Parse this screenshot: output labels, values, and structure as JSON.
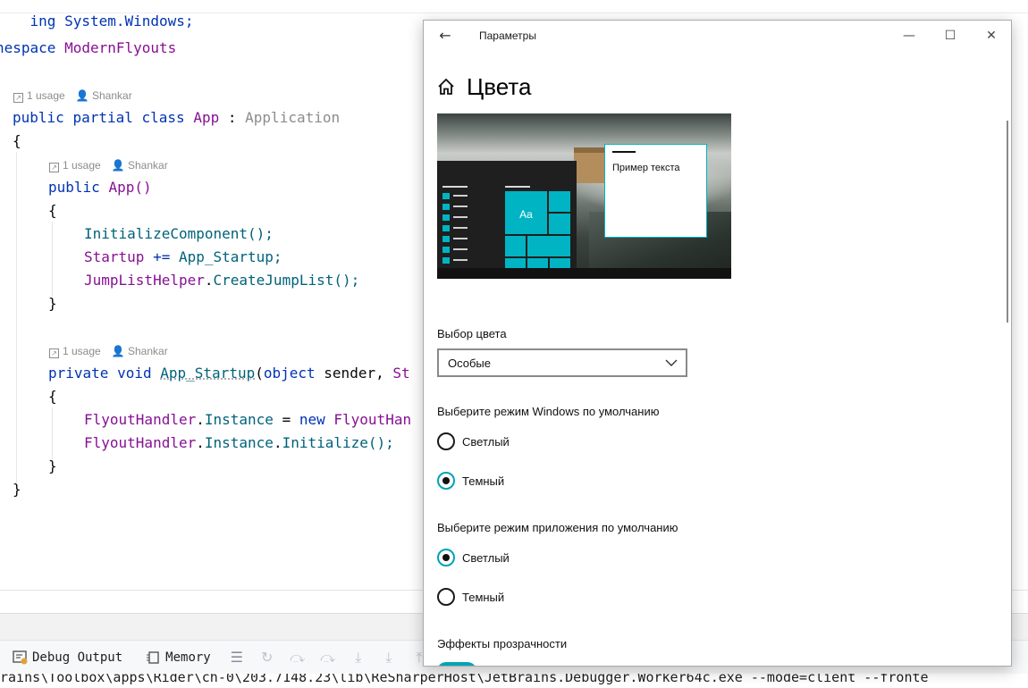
{
  "editor": {
    "line_using": "ing System.Windows;",
    "ns_keyword": "nespace",
    "ns_name": "ModernFlyouts",
    "hint_usage": "1 usage",
    "hint_author": "Shankar",
    "class_public": "public",
    "class_partial": "partial",
    "class_class": "class",
    "class_name": "App",
    "class_colon": ":",
    "class_base": "Application",
    "brace_open": "{",
    "brace_close": "}",
    "ctor_public": "public",
    "ctor_name": "App()",
    "init_call": "InitializeComponent();",
    "startup_ev": "Startup",
    "startup_op": " += ",
    "startup_handler": "App_Startup;",
    "jump_cls": "JumpListHelper",
    "jump_dot": ".",
    "jump_call": "CreateJumpList();",
    "m_private": "private",
    "m_void": "void",
    "m_name": "App_Startup",
    "m_paren": "(",
    "m_object": "object",
    "m_sender": " sender, ",
    "m_st": "St",
    "fh_cls": "FlyoutHandler",
    "fh_inst": "Instance",
    "fh_eq": " = ",
    "fh_new": "new",
    "fh_cut": "FlyoutHan",
    "fh_init": "Initialize();"
  },
  "toolbar": {
    "debug_output": "Debug Output",
    "memory": "Memory"
  },
  "console": {
    "text": "rains\\Toolbox\\apps\\Rider\\ch-0\\203.7148.23\\lib\\ReSharperHost\\JetBrains.Debugger.Worker64c.exe --mode=client --fronte"
  },
  "settings": {
    "window_title": "Параметры",
    "page_title": "Цвета",
    "preview_sample_text": "Пример текста",
    "preview_tile_text": "Aa",
    "color_choice_label": "Выбор цвета",
    "color_choice_value": "Особые",
    "windows_mode_label": "Выберите режим Windows по умолчанию",
    "windows_mode_options": [
      "Светлый",
      "Темный"
    ],
    "windows_mode_selected": "Темный",
    "app_mode_label": "Выберите режим приложения по умолчанию",
    "app_mode_options": [
      "Светлый",
      "Темный"
    ],
    "app_mode_selected": "Светлый",
    "transparency_label": "Эффекты прозрачности",
    "transparency_on": true,
    "accent_color": "#00b4c4"
  }
}
